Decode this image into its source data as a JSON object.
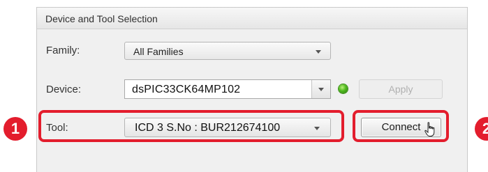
{
  "panel": {
    "title": "Device and Tool Selection"
  },
  "family": {
    "label": "Family:",
    "value": "All Families"
  },
  "device": {
    "label": "Device:",
    "value": "dsPIC33CK64MP102",
    "status_color": "#4fb81e",
    "apply_label": "Apply"
  },
  "tool": {
    "label": "Tool:",
    "value": "ICD 3 S.No : BUR212674100",
    "connect_label": "Connect"
  },
  "callouts": {
    "first": "1",
    "second": "2",
    "color": "#e31d2d"
  }
}
